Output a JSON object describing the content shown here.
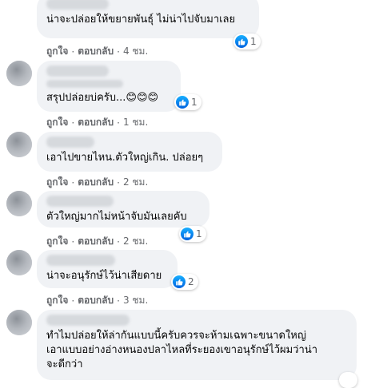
{
  "like_label": "ถูกใจ",
  "reply_label": "ตอบกลับ",
  "dot": "·",
  "comments": [
    {
      "text": "น่าจะปล่อยให้ขยายพันธุ์ ไม่น่าไปจับมาเลย",
      "reactions": "1",
      "time": "4 ชม."
    },
    {
      "text": "สรุปปล่อยบ่ครับ...😊😊😊",
      "reactions": "1",
      "time": "1 ชม."
    },
    {
      "text": "เอาไปขายไหน.ตัวใหญ่เกิน. ปล่อยๆ",
      "reactions": "",
      "time": "2 ชม."
    },
    {
      "text": "ตัวใหญ่มากไม่หน้าจับมันเลยคับ",
      "reactions": "1",
      "time": "2 ชม."
    },
    {
      "text": "น่าจะอนุรักษ์ไว้น่าเสียดาย",
      "reactions": "2",
      "time": "3 ชม."
    },
    {
      "text": "ทำไมปล่อยให้ล่ากันแบบนี้ครับควรจะห้ามเฉพาะขนาดใหญ่\nเอาแบบอย่างอ่างหนองปลาไหลที่ระยองเขาอนุรักษ์ไว้ผมว่าน่า\nจะดีกว่า",
      "reactions": "",
      "time": ""
    }
  ],
  "colors": {
    "bubble": "#f0f2f5",
    "like": "#1877f2",
    "meta": "#65676b"
  }
}
